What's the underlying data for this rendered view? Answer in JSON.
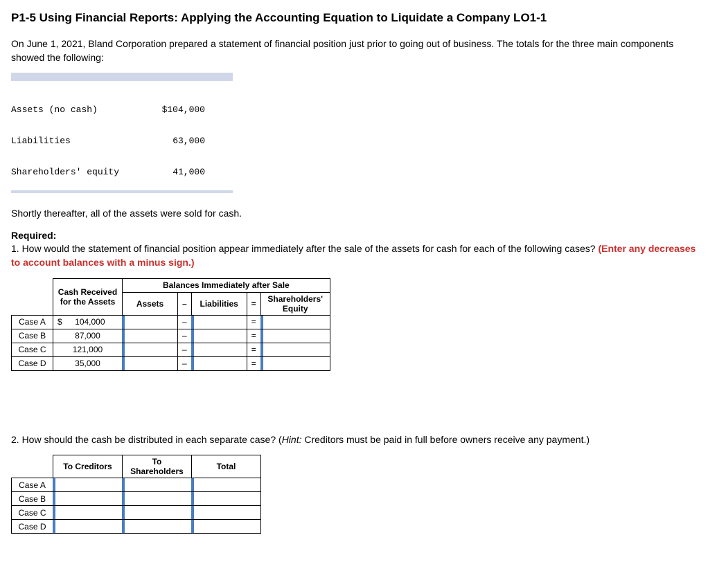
{
  "title": "P1-5 Using Financial Reports: Applying the Accounting Equation to Liquidate a Company LO1-1",
  "intro": "On June 1, 2021, Bland Corporation prepared a statement of financial position just prior to going out of business. The totals for the three main components showed the following:",
  "components": {
    "r1": {
      "label": "Assets (no cash)",
      "value": "$104,000"
    },
    "r2": {
      "label": "Liabilities",
      "value": "63,000"
    },
    "r3": {
      "label": "Shareholders' equity",
      "value": "41,000"
    }
  },
  "after": "Shortly thereafter, all of the assets were sold for cash.",
  "required_label": "Required:",
  "q1_text": "1. How would the statement of financial position appear immediately after the sale of the assets for cash for each of the following cases? ",
  "q1_hint": "(Enter any decreases to account balances with a minus sign.)",
  "t1": {
    "h_cash": "Cash Received for the Assets",
    "h_bal": "Balances Immediately after Sale",
    "h_assets": "Assets",
    "h_liab": "Liabilities",
    "h_eq": "Shareholders' Equity",
    "rows": [
      {
        "label": "Case A",
        "cur": "$",
        "cash": "104,000"
      },
      {
        "label": "Case B",
        "cur": "",
        "cash": "87,000"
      },
      {
        "label": "Case C",
        "cur": "",
        "cash": "121,000"
      },
      {
        "label": "Case D",
        "cur": "",
        "cash": "35,000"
      }
    ],
    "minus": "–",
    "equals": "="
  },
  "q2_text": "2. How should the cash be distributed in each separate case? (",
  "q2_hint_label": "Hint:",
  "q2_hint_rest": " Creditors must be paid in full before owners receive any payment.)",
  "t2": {
    "h_cred": "To Creditors",
    "h_share": "To Shareholders",
    "h_total": "Total",
    "rows": [
      {
        "label": "Case A"
      },
      {
        "label": "Case B"
      },
      {
        "label": "Case C"
      },
      {
        "label": "Case D"
      }
    ]
  }
}
